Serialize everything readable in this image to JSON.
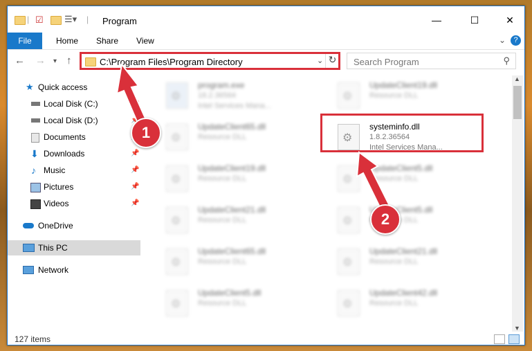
{
  "window": {
    "title": "Program",
    "quick_access_icons": [
      "folder-icon",
      "properties-icon",
      "new-folder-icon",
      "view-menu-icon"
    ],
    "controls": [
      "minimize",
      "maximize",
      "close"
    ]
  },
  "ribbon": {
    "file": "File",
    "tabs": [
      "Home",
      "Share",
      "View"
    ]
  },
  "address_bar": {
    "path": "C:\\Program Files\\Program Directory",
    "search_placeholder": "Search Program"
  },
  "navigation": {
    "items": [
      {
        "label": "Quick access",
        "icon": "star-icon",
        "pinned": false
      },
      {
        "label": "Local Disk (C:)",
        "icon": "drive-icon",
        "pinned": true
      },
      {
        "label": "Local Disk (D:)",
        "icon": "drive-icon",
        "pinned": true
      },
      {
        "label": "Documents",
        "icon": "documents-icon",
        "pinned": true
      },
      {
        "label": "Downloads",
        "icon": "downloads-icon",
        "pinned": true
      },
      {
        "label": "Music",
        "icon": "music-icon",
        "pinned": true
      },
      {
        "label": "Pictures",
        "icon": "pictures-icon",
        "pinned": true
      },
      {
        "label": "Videos",
        "icon": "videos-icon",
        "pinned": true
      },
      {
        "label": "OneDrive",
        "icon": "onedrive-icon",
        "pinned": false
      },
      {
        "label": "This PC",
        "icon": "computer-icon",
        "pinned": false,
        "selected": true
      },
      {
        "label": "Network",
        "icon": "network-icon",
        "pinned": false
      }
    ]
  },
  "files": [
    {
      "name": "program.exe",
      "line2": "18.2.36564",
      "line3": "Intel Services Mana..."
    },
    {
      "name": "UpdateClient19.dll",
      "line2": "Resource DLL",
      "line3": ""
    },
    {
      "name": "UpdateClient65.dll",
      "line2": "Resource DLL",
      "line3": ""
    },
    {
      "name": "systeminfo.dll",
      "line2": "1.8.2.36564",
      "line3": "Intel Services Mana...",
      "highlighted": true
    },
    {
      "name": "UpdateClient19.dll",
      "line2": "Resource DLL",
      "line3": ""
    },
    {
      "name": "UpdateClient5.dll",
      "line2": "Resource DLL",
      "line3": ""
    },
    {
      "name": "UpdateClient21.dll",
      "line2": "Resource DLL",
      "line3": ""
    },
    {
      "name": "UpdateClient5.dll",
      "line2": "Resource DLL",
      "line3": ""
    },
    {
      "name": "UpdateClient65.dll",
      "line2": "Resource DLL",
      "line3": ""
    },
    {
      "name": "UpdateClient21.dll",
      "line2": "Resource DLL",
      "line3": ""
    },
    {
      "name": "UpdateClient5.dll",
      "line2": "Resource DLL",
      "line3": ""
    },
    {
      "name": "UpdateClient42.dll",
      "line2": "Resource DLL",
      "line3": ""
    }
  ],
  "status": {
    "item_count": "127 items"
  },
  "callouts": [
    "1",
    "2"
  ],
  "colors": {
    "accent": "#1979ca",
    "callout": "#d9303a"
  }
}
